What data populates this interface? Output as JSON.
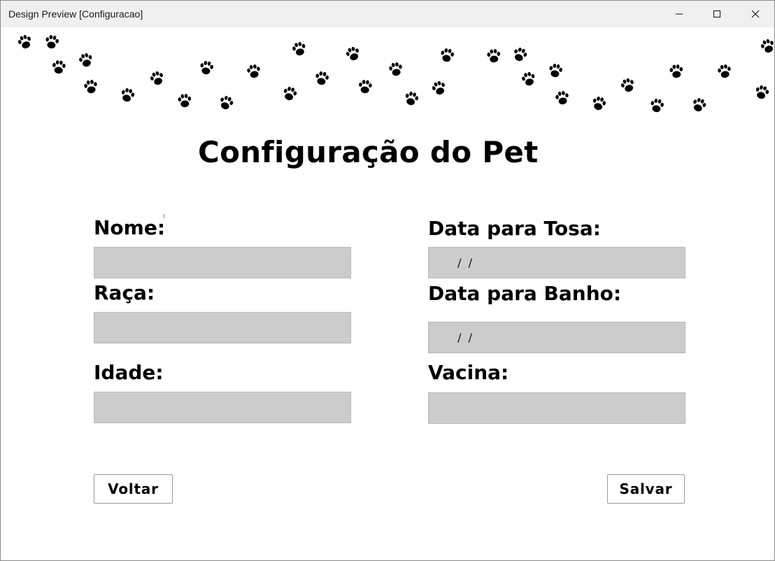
{
  "window": {
    "title": "Design Preview [Configuracao]",
    "controls": [
      "minimize-icon",
      "maximize-icon",
      "close-icon"
    ]
  },
  "header": {
    "decoration": "paw-prints-icon",
    "title": "Configuração do Pet"
  },
  "form": {
    "left": [
      {
        "label": "Nome:",
        "value": ""
      },
      {
        "label": "Raça:",
        "value": ""
      },
      {
        "label": "Idade:",
        "value": ""
      }
    ],
    "right": [
      {
        "label": "Data para Tosa:",
        "value": " /  /"
      },
      {
        "label": "Data para Banho:",
        "value": " /  /"
      },
      {
        "label": "Vacina:",
        "value": ""
      }
    ]
  },
  "actions": {
    "back_label": "Voltar",
    "save_label": "Salvar"
  },
  "colors": {
    "field_bg": "#cccccc",
    "titlebar_bg": "#f0f0f0",
    "text": "#000000"
  }
}
